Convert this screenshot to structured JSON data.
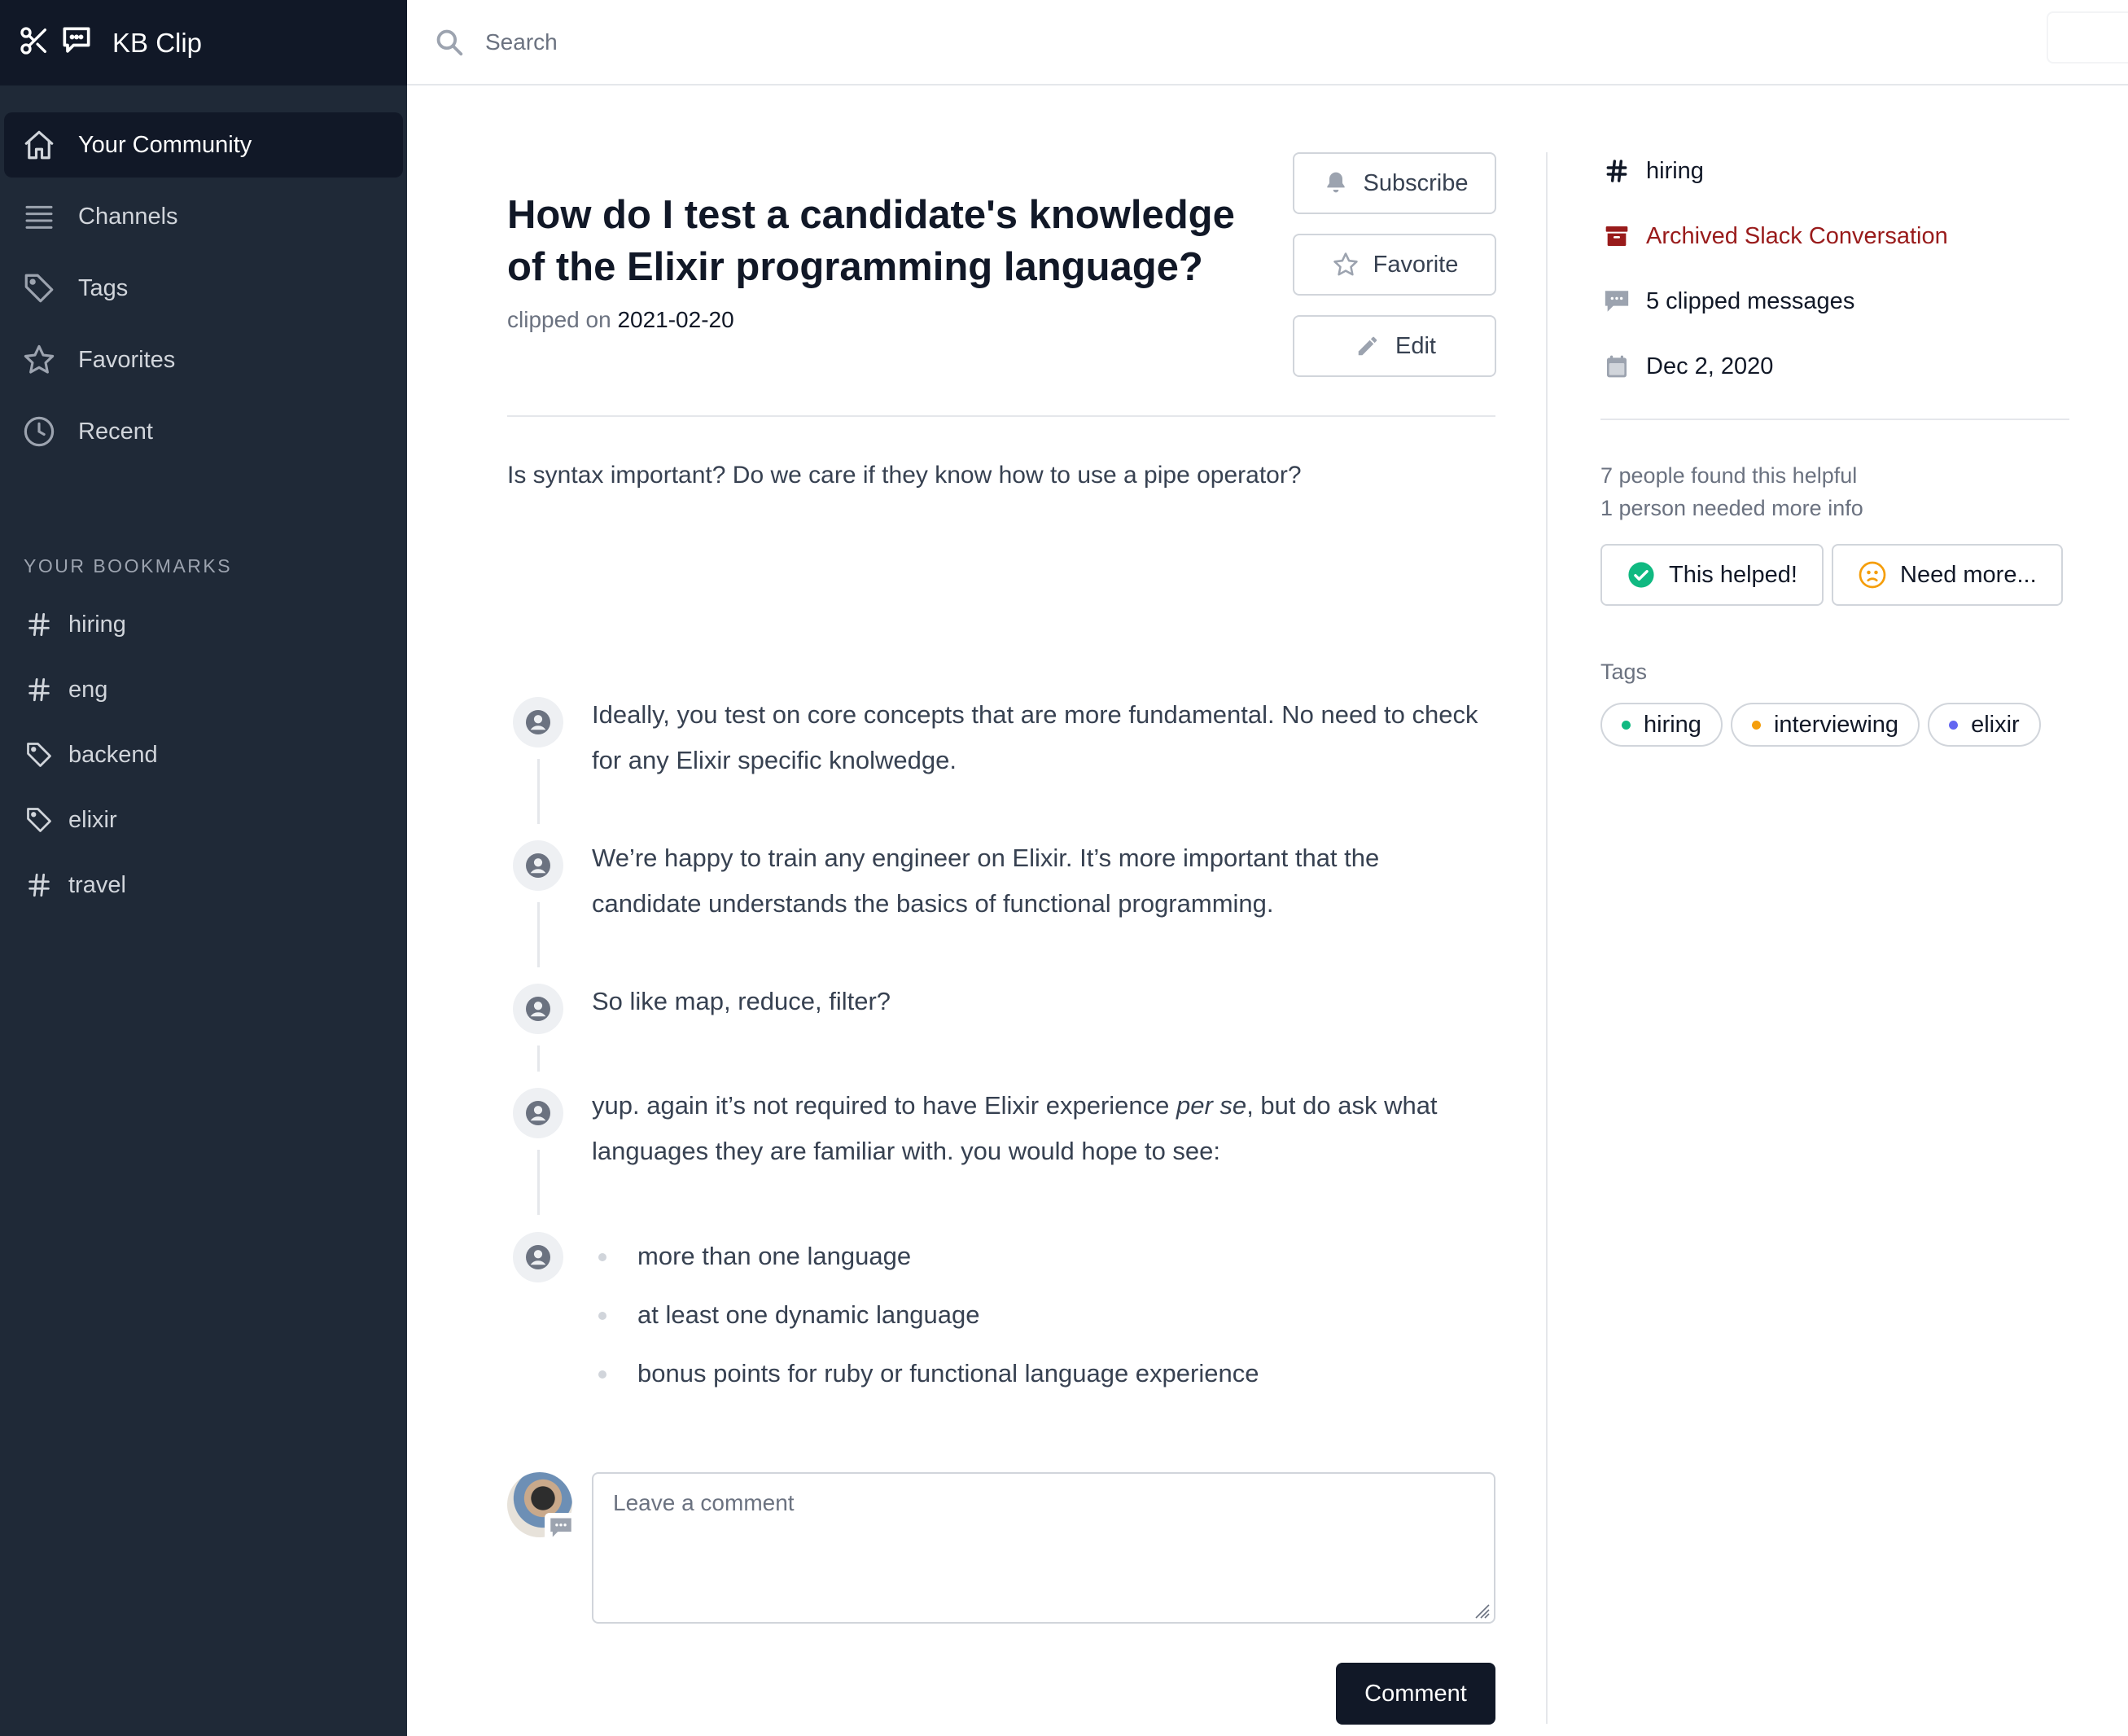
{
  "app": {
    "title": "KB Clip"
  },
  "sidebar": {
    "nav": [
      {
        "label": "Your Community",
        "icon": "home-icon",
        "active": true
      },
      {
        "label": "Channels",
        "icon": "channels-icon",
        "active": false
      },
      {
        "label": "Tags",
        "icon": "tag-icon",
        "active": false
      },
      {
        "label": "Favorites",
        "icon": "star-icon",
        "active": false
      },
      {
        "label": "Recent",
        "icon": "clock-icon",
        "active": false
      }
    ],
    "bookmarks_heading": "YOUR BOOKMARKS",
    "bookmarks": [
      {
        "label": "hiring",
        "icon": "hash-icon"
      },
      {
        "label": "eng",
        "icon": "hash-icon"
      },
      {
        "label": "backend",
        "icon": "tag-icon"
      },
      {
        "label": "elixir",
        "icon": "tag-icon"
      },
      {
        "label": "travel",
        "icon": "hash-icon"
      }
    ]
  },
  "search": {
    "placeholder": "Search",
    "value": ""
  },
  "clip": {
    "title": "How do I test a candidate's knowledge of the Elixir programming language?",
    "clipped_prefix": "clipped on",
    "clipped_date": "2021-02-20",
    "question": "Is syntax important? Do we care if they know how to use a pipe operator?"
  },
  "actions": {
    "subscribe": "Subscribe",
    "favorite": "Favorite",
    "edit": "Edit"
  },
  "messages": [
    {
      "text": "Ideally, you test on core concepts that are more fundamental. No need to check for any Elixir specific knolwedge."
    },
    {
      "text": "We’re happy to train any engineer on Elixir. It’s more important that the candidate understands the basics of functional programming."
    },
    {
      "text": "So like map, reduce, filter?"
    },
    {
      "text_before": "yup. again it’s not required to have Elixir experience ",
      "text_em": "per se",
      "text_after": ", but do ask what languages they are familiar with. you would hope to see:"
    },
    {
      "bullets": [
        "more than one language",
        "at least one dynamic language",
        "bonus points for ruby or functional language experience"
      ]
    }
  ],
  "comment": {
    "placeholder": "Leave a comment",
    "value": "",
    "button": "Comment"
  },
  "meta": {
    "channel": "hiring",
    "source": "Archived Slack Conversation",
    "messages_count": "5 clipped messages",
    "date": "Dec 2, 2020"
  },
  "helpful": {
    "found": "7 people found this helpful",
    "needed": "1 person needed more info",
    "helped_button": "This helped!",
    "need_more_button": "Need more..."
  },
  "tags": {
    "label": "Tags",
    "items": [
      {
        "label": "hiring",
        "color": "#10b981"
      },
      {
        "label": "interviewing",
        "color": "#f59e0b"
      },
      {
        "label": "elixir",
        "color": "#6366f1"
      }
    ]
  },
  "colors": {
    "sidebar_bg": "#1f2937",
    "sidebar_active": "#111827",
    "archived": "#991b1b",
    "helped": "#10b981",
    "need_more": "#f59e0b"
  }
}
